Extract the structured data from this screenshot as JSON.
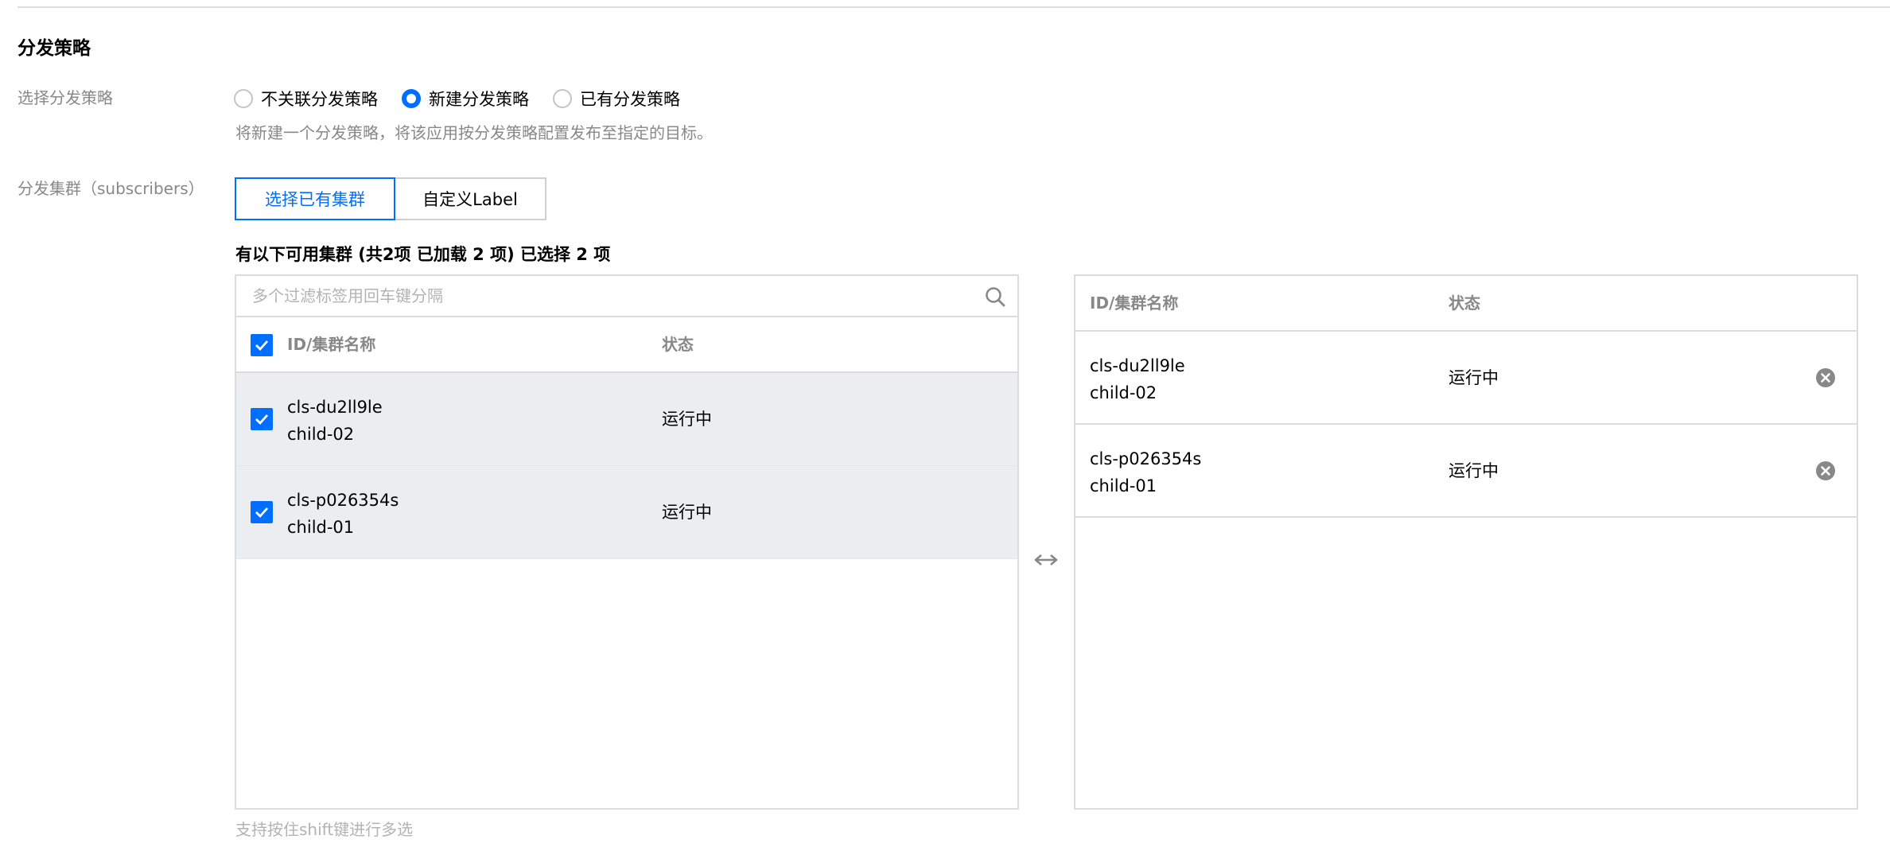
{
  "section": {
    "title": "分发策略"
  },
  "strategy": {
    "label": "选择分发策略",
    "options": [
      {
        "label": "不关联分发策略",
        "checked": false
      },
      {
        "label": "新建分发策略",
        "checked": true
      },
      {
        "label": "已有分发策略",
        "checked": false
      }
    ],
    "help": "将新建一个分发策略，将该应用按分发策略配置发布至指定的目标。"
  },
  "subscribers": {
    "label": "分发集群（subscribers）",
    "tabs": [
      {
        "label": "选择已有集群",
        "active": true
      },
      {
        "label": "自定义Label",
        "active": false
      }
    ],
    "summary": "有以下可用集群 (共2项 已加载 2 项) 已选择 2 项"
  },
  "source": {
    "search_placeholder": "多个过滤标签用回车键分隔",
    "columns": {
      "name": "ID/集群名称",
      "status": "状态"
    },
    "select_all_checked": true,
    "rows": [
      {
        "id": "cls-du2ll9le",
        "name": "child-02",
        "status": "运行中",
        "checked": true
      },
      {
        "id": "cls-p026354s",
        "name": "child-01",
        "status": "运行中",
        "checked": true
      }
    ]
  },
  "target": {
    "columns": {
      "name": "ID/集群名称",
      "status": "状态"
    },
    "rows": [
      {
        "id": "cls-du2ll9le",
        "name": "child-02",
        "status": "运行中"
      },
      {
        "id": "cls-p026354s",
        "name": "child-01",
        "status": "运行中"
      }
    ]
  },
  "footer": {
    "tip": "支持按住shift键进行多选"
  },
  "colors": {
    "primary": "#006eff",
    "label_gray": "#888888",
    "border": "#dcdcdc",
    "selected_row_bg": "#ebedf0",
    "placeholder_gray": "#b3b3b3"
  },
  "icons": {
    "search": "search-icon",
    "transfer": "transfer-arrows-icon",
    "remove": "remove-circle-icon",
    "checkbox": "checkbox-checked-icon"
  }
}
